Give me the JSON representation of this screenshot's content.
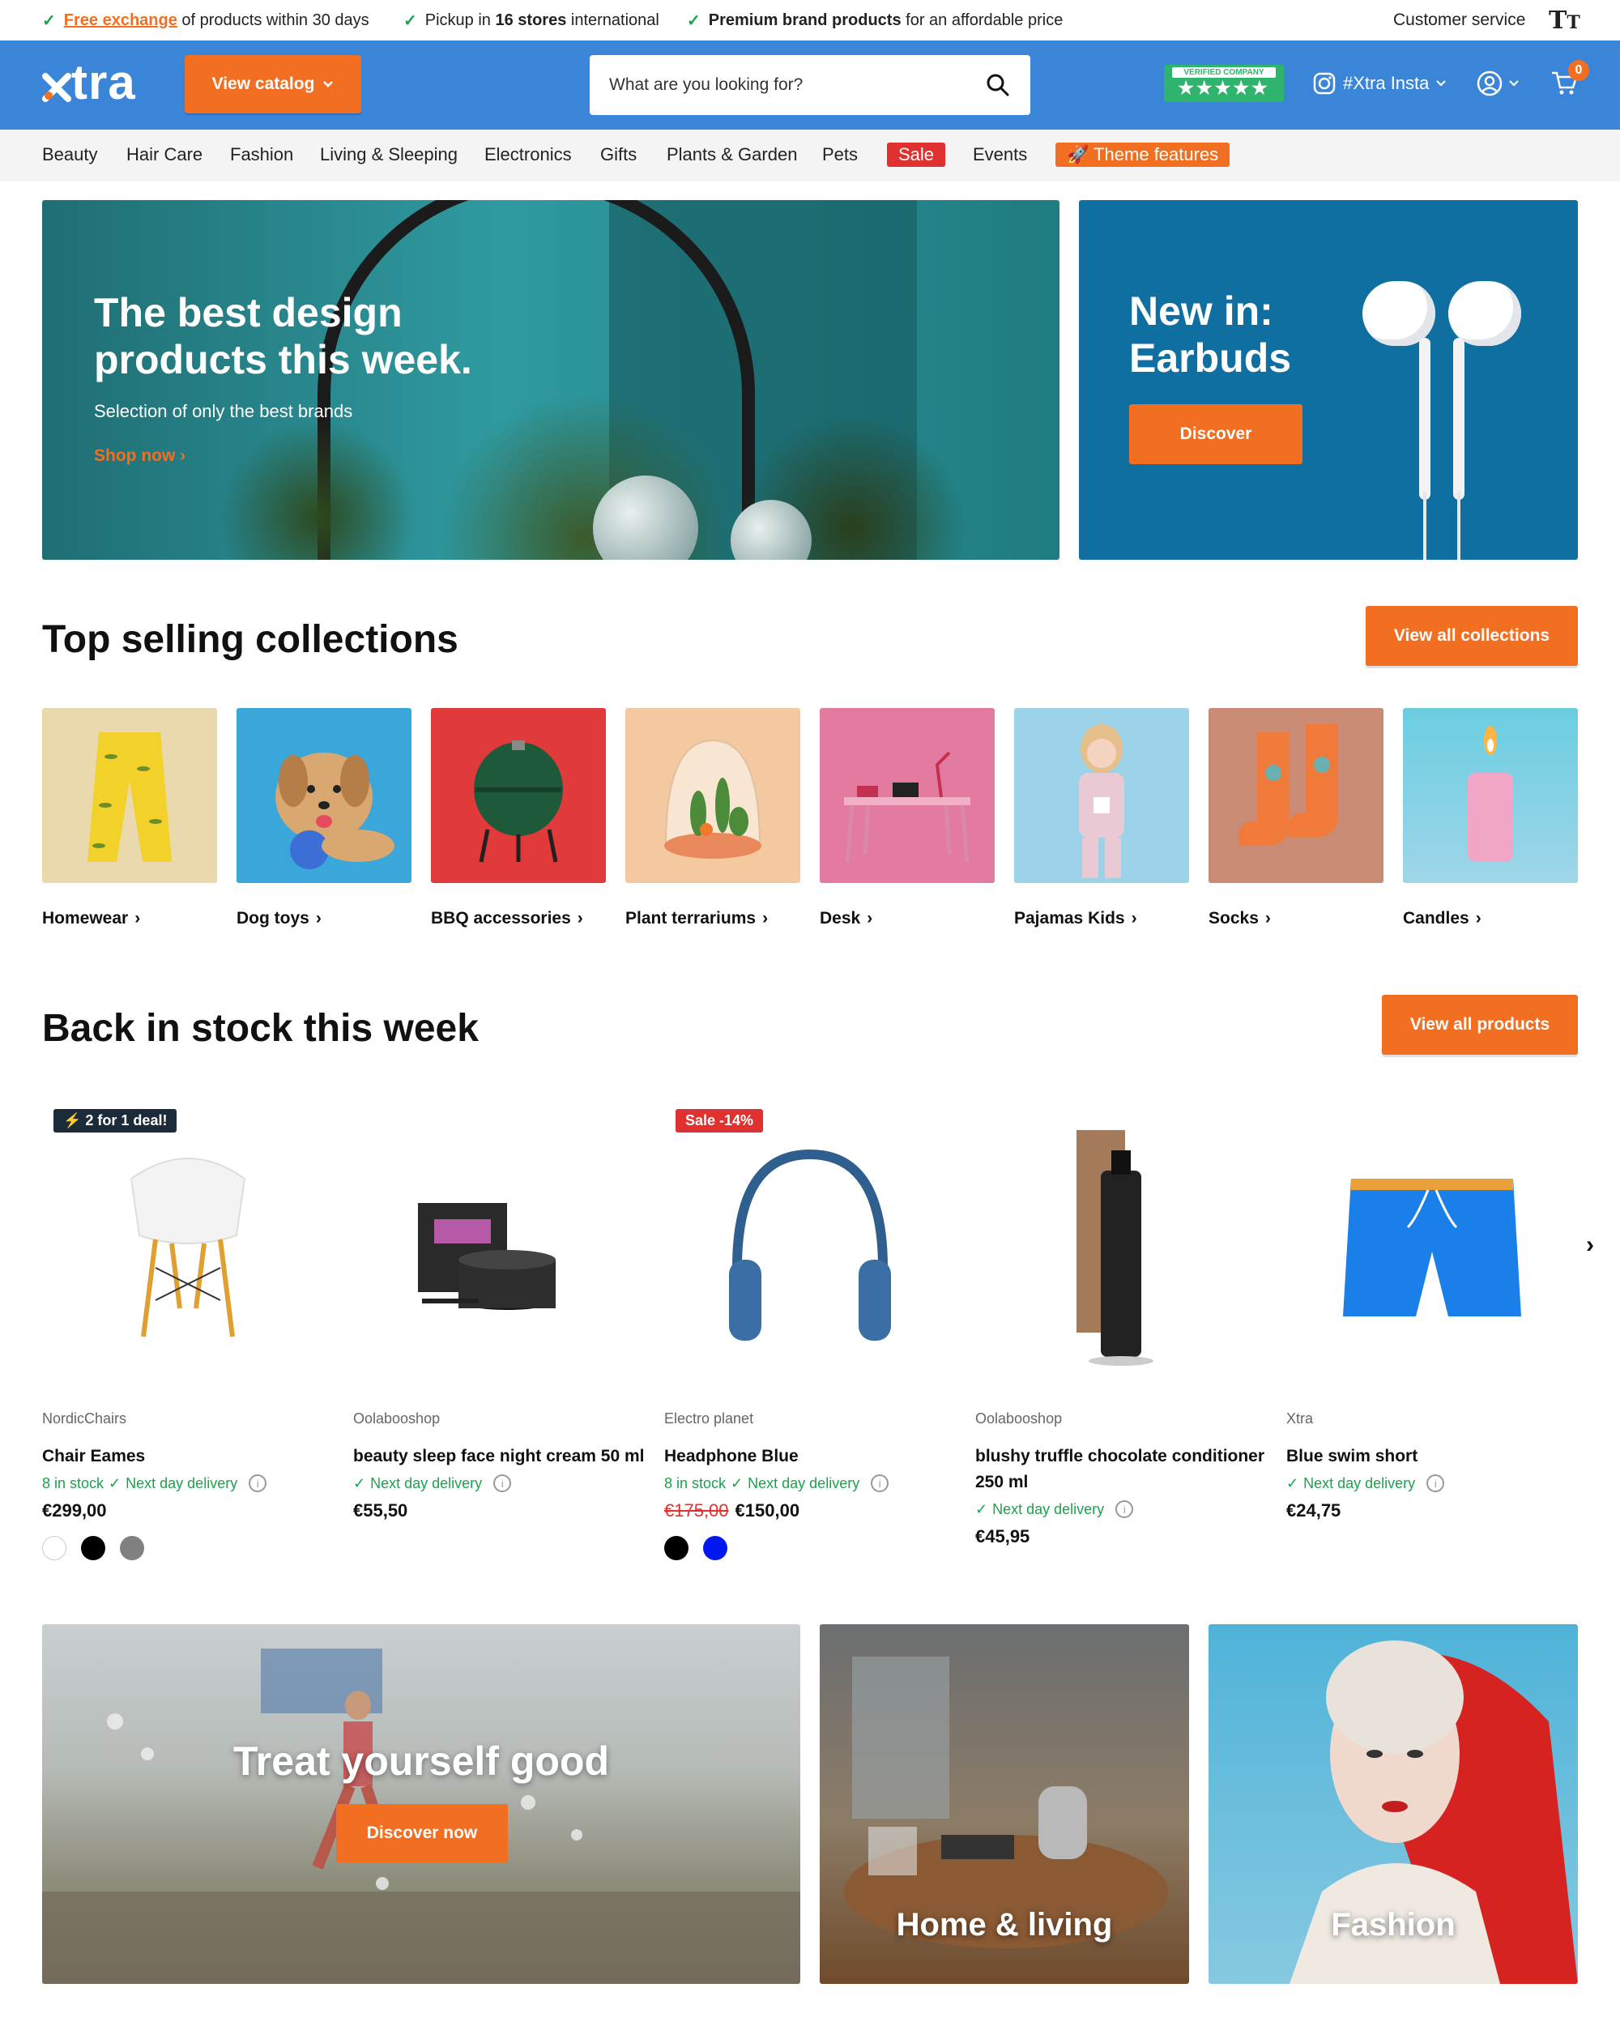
{
  "usp": {
    "items": [
      {
        "link": "Free exchange",
        "text": " of products within 30 days"
      },
      {
        "pre": "Pickup in ",
        "bold": "16 stores",
        "text": " international"
      },
      {
        "bold": "Premium brand products",
        "text": " for an affordable price"
      }
    ],
    "customer_service": "Customer service",
    "text_size_icon": "TT"
  },
  "header": {
    "logo": "xtra",
    "catalog_button": "View catalog",
    "search_placeholder": "What are you looking for?",
    "trust_badge": "VERIFIED COMPANY",
    "trust_stars": "★★★★★",
    "instagram": "#Xtra Insta",
    "cart_count": "0",
    "brand_color": "#3a85d8",
    "accent_color": "#f26f21"
  },
  "nav": {
    "items": [
      "Beauty",
      "Hair Care",
      "Fashion",
      "Living & Sleeping",
      "Electronics",
      "Gifts",
      "Plants & Garden",
      "Pets",
      "Sale",
      "Events",
      "Theme features"
    ]
  },
  "hero": {
    "main_title": "The best design products this week.",
    "main_subtitle": "Selection of only the best brands",
    "main_link": "Shop now",
    "side_title": "New in: Earbuds",
    "side_button": "Discover"
  },
  "collections": {
    "title": "Top selling collections",
    "button": "View all collections",
    "items": [
      {
        "label": "Homewear"
      },
      {
        "label": "Dog toys"
      },
      {
        "label": "BBQ accessories"
      },
      {
        "label": "Plant terrariums"
      },
      {
        "label": "Desk"
      },
      {
        "label": "Pajamas Kids"
      },
      {
        "label": "Socks"
      },
      {
        "label": "Candles"
      }
    ]
  },
  "products": {
    "title": "Back in stock this week",
    "button": "View all products",
    "items": [
      {
        "badge": "⚡ 2 for 1 deal!",
        "brand": "NordicChairs",
        "name": "Chair Eames",
        "stock": "8 in stock",
        "delivery": "Next day delivery",
        "price": "€299,00",
        "old_price": ""
      },
      {
        "badge": "",
        "brand": "Oolabooshop",
        "name": "beauty sleep face night cream 50 ml",
        "stock": "",
        "delivery": "Next day delivery",
        "price": "€55,50",
        "old_price": ""
      },
      {
        "badge": "Sale -14%",
        "brand": "Electro planet",
        "name": "Headphone Blue",
        "stock": "8 in stock",
        "delivery": "Next day delivery",
        "price": "€150,00",
        "old_price": "€175,00"
      },
      {
        "badge": "",
        "brand": "Oolabooshop",
        "name": "blushy truffle chocolate condition­er 250 ml",
        "stock": "",
        "delivery": "Next day delivery",
        "price": "€45,95",
        "old_price": ""
      },
      {
        "badge": "",
        "brand": "Xtra",
        "name": "Blue swim short",
        "stock": "",
        "delivery": "Next day delivery",
        "price": "€24,75",
        "old_price": ""
      }
    ]
  },
  "banners": {
    "left_title": "Treat yourself good",
    "left_button": "Discover now",
    "middle": "Home & living",
    "right": "Fashion"
  }
}
